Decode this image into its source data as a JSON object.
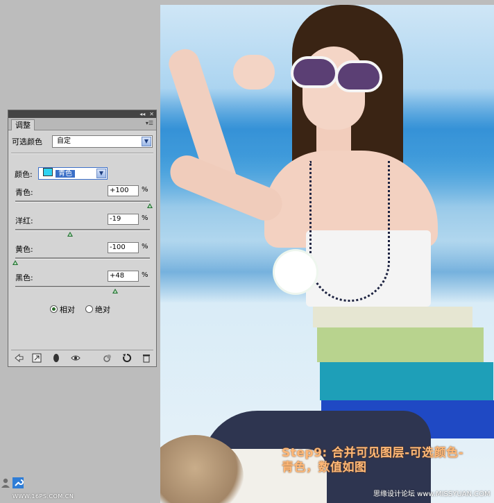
{
  "panel": {
    "tab_label": "调整",
    "header_controls": [
      "◂◂",
      "✕"
    ],
    "tab_menu": "▾☰",
    "preset_label": "可选颜色",
    "preset_value": "自定",
    "colors_label": "颜色:",
    "colors_value": "青色",
    "swatch_color": "#2fd3f2",
    "sliders": [
      {
        "label": "青色:",
        "value": "+100",
        "unit": "%",
        "level": 1.0
      },
      {
        "label": "洋红:",
        "value": "-19",
        "unit": "%",
        "level": 0.405
      },
      {
        "label": "黄色:",
        "value": "-100",
        "unit": "%",
        "level": 0.0
      },
      {
        "label": "黑色:",
        "value": "+48",
        "unit": "%",
        "level": 0.74
      }
    ],
    "method_relative": "相对",
    "method_absolute": "绝对",
    "method_selected": "relative",
    "footer_icons": [
      "back-arrow-icon",
      "expand-view-icon",
      "clip-layer-icon",
      "visibility-eye-icon",
      "previous-state-icon",
      "reset-icon",
      "delete-icon"
    ]
  },
  "photo": {
    "step_text": "Step9: 合并可见图层-可选颜色-\n青色，数值如图",
    "watermark_right": "思缘设计论坛 www.MISSYUAN.COM",
    "watermark_left": "WWW.16PS.COM.CN"
  },
  "colors": {
    "panel_bg": "#d4d4d4",
    "desktop_bg": "#bcbcbc",
    "step_text": "#ffb877",
    "slider_thumb": "#1e6e2d"
  }
}
